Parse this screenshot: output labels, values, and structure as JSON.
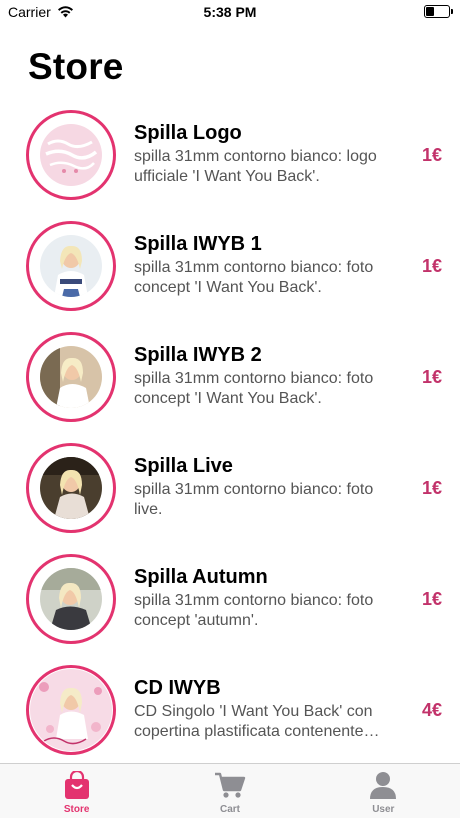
{
  "status_bar": {
    "carrier": "Carrier",
    "time": "5:38 PM"
  },
  "page": {
    "title": "Store"
  },
  "colors": {
    "accent": "#e3336f",
    "price": "#c2326a",
    "inactive_tab": "#8e8e93"
  },
  "products": [
    {
      "title": "Spilla Logo",
      "description": "spilla 31mm contorno bianco: logo ufficiale 'I Want You Back'.",
      "price": "1€",
      "image": "logo-badge"
    },
    {
      "title": "Spilla IWYB 1",
      "description": "spilla 31mm contorno bianco: foto concept 'I Want You Back'.",
      "price": "1€",
      "image": "photo-concept-1"
    },
    {
      "title": "Spilla IWYB 2",
      "description": "spilla 31mm contorno bianco: foto concept 'I Want You Back'.",
      "price": "1€",
      "image": "photo-concept-2"
    },
    {
      "title": "Spilla Live",
      "description": "spilla 31mm contorno bianco: foto live.",
      "price": "1€",
      "image": "photo-live"
    },
    {
      "title": "Spilla Autumn",
      "description": "spilla 31mm contorno bianco: foto concept 'autumn'.",
      "price": "1€",
      "image": "photo-autumn"
    },
    {
      "title": "CD IWYB",
      "description": "CD Singolo 'I Want You Back' con copertina plastificata contenente…",
      "price": "4€",
      "image": "cd-cover"
    }
  ],
  "tab_bar": {
    "active": "Store",
    "tabs": [
      {
        "label": "Store",
        "icon": "bag-icon"
      },
      {
        "label": "Cart",
        "icon": "cart-icon"
      },
      {
        "label": "User",
        "icon": "user-icon"
      }
    ]
  }
}
